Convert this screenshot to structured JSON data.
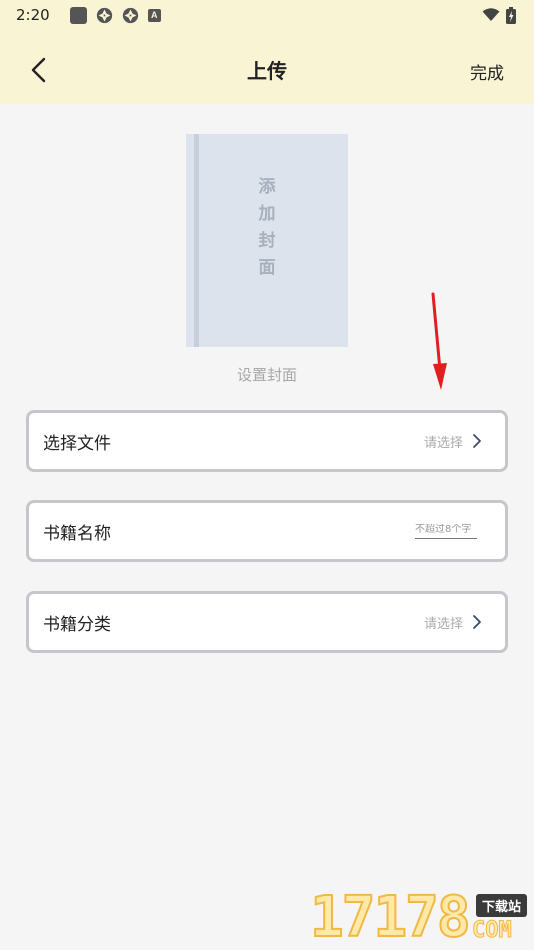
{
  "status_bar": {
    "time": "2:20",
    "icons": [
      "square-icon",
      "aperture-icon",
      "aperture-icon",
      "a-icon",
      "wifi-icon",
      "battery-icon"
    ],
    "a_glyph": "A"
  },
  "header": {
    "title": "上传",
    "back_icon": "chevron-left-icon",
    "done_label": "完成"
  },
  "cover": {
    "placeholder_text": "添加封面",
    "caption": "设置封面"
  },
  "form": {
    "file_row": {
      "label": "选择文件",
      "hint": "请选择"
    },
    "name_row": {
      "label": "书籍名称",
      "placeholder": "不超过8个字",
      "value": ""
    },
    "category_row": {
      "label": "书籍分类",
      "hint": "请选择"
    }
  },
  "watermark": {
    "digits": "17178",
    "badge": "下载站",
    "suffix": "COM"
  },
  "colors": {
    "header_bg": "#f8f4d4",
    "page_bg": "#f5f5f5",
    "cover_bg": "#dde3ec",
    "row_border": "#c7c7cb",
    "arrow": "#e02020"
  }
}
